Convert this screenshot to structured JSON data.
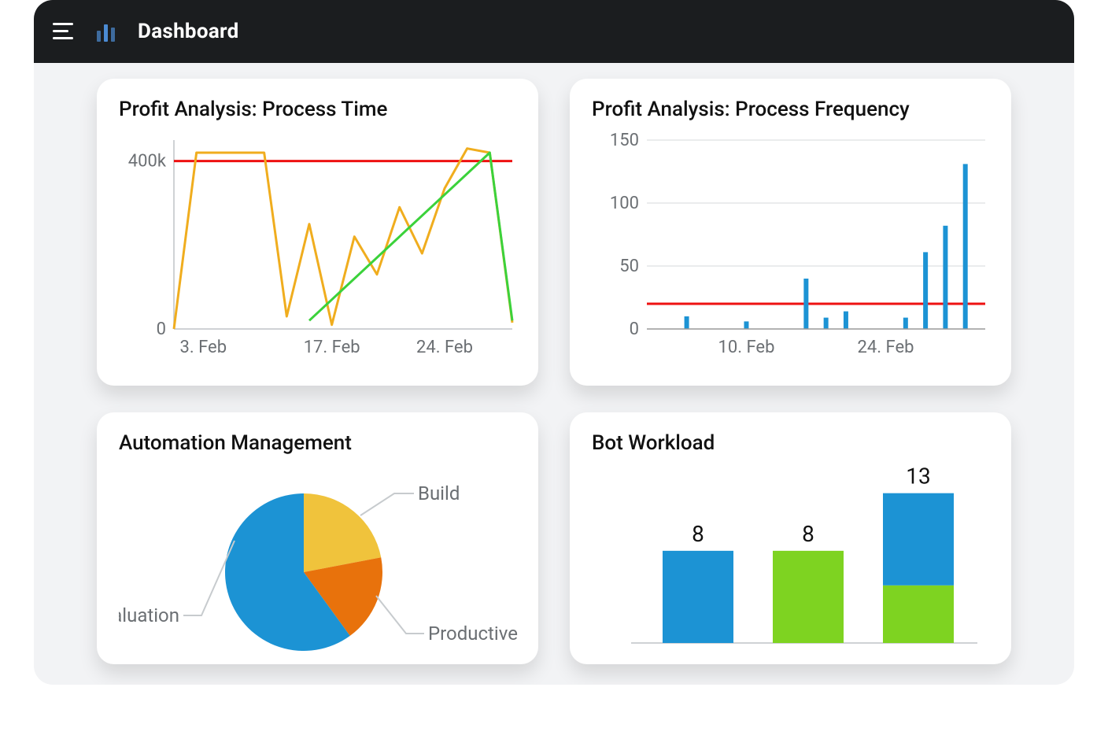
{
  "header": {
    "title": "Dashboard"
  },
  "cards": {
    "process_time": {
      "title": "Profit Analysis: Process Time"
    },
    "process_frequency": {
      "title": "Profit Analysis: Process Frequency"
    },
    "automation": {
      "title": "Automation Management"
    },
    "bot_workload": {
      "title": "Bot Workload"
    }
  },
  "chart_data": [
    {
      "id": "process_time",
      "type": "line",
      "x_ticks": [
        "3. Feb",
        "17. Feb",
        "24. Feb"
      ],
      "y_ticks": [
        0,
        400000
      ],
      "y_tick_labels": [
        "0",
        "400k"
      ],
      "ylim": [
        0,
        450000
      ],
      "reference_line": 400000,
      "series": [
        {
          "name": "orange",
          "color": "#f0ad1e",
          "x": [
            0,
            1,
            2,
            3,
            4,
            5,
            6,
            7,
            8,
            9,
            10,
            11,
            12,
            13,
            14,
            15
          ],
          "y": [
            0,
            420000,
            420000,
            420000,
            420000,
            30000,
            250000,
            10000,
            220000,
            130000,
            290000,
            180000,
            335000,
            430000,
            420000,
            15000
          ]
        },
        {
          "name": "green",
          "color": "#3bd23b",
          "x": [
            6,
            14,
            15
          ],
          "y": [
            20000,
            420000,
            20000
          ]
        }
      ]
    },
    {
      "id": "process_frequency",
      "type": "bar",
      "x_ticks": [
        "10. Feb",
        "24. Feb"
      ],
      "y_ticks": [
        0,
        50,
        100,
        150
      ],
      "ylim": [
        0,
        150
      ],
      "reference_line": 20,
      "series": [
        {
          "name": "count",
          "color": "#1c93d4",
          "x": [
            2,
            5,
            8,
            9,
            10,
            13,
            14,
            15,
            16
          ],
          "y": [
            10,
            6,
            40,
            9,
            14,
            9,
            61,
            82,
            131
          ]
        }
      ]
    },
    {
      "id": "automation",
      "type": "pie",
      "slices": [
        {
          "label": "Evaluation",
          "value": 60,
          "color": "#1c93d4"
        },
        {
          "label": "Build",
          "value": 22,
          "color": "#f0c33c"
        },
        {
          "label": "Productive",
          "value": 18,
          "color": "#e8720c"
        }
      ]
    },
    {
      "id": "bot_workload",
      "type": "stacked-bar",
      "categories": [
        "",
        "",
        ""
      ],
      "series": [
        {
          "name": "blue",
          "color": "#1c93d4",
          "values": [
            8,
            0,
            8
          ]
        },
        {
          "name": "green",
          "color": "#7ed321",
          "values": [
            0,
            8,
            5
          ]
        }
      ],
      "totals": [
        8,
        8,
        13
      ]
    }
  ]
}
